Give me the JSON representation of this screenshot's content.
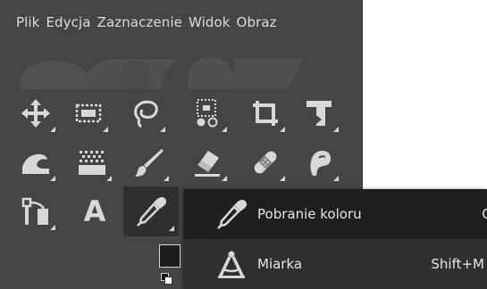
{
  "menubar": {
    "items": [
      {
        "label": "Plik"
      },
      {
        "label": "Edycja"
      },
      {
        "label": "Zaznaczenie"
      },
      {
        "label": "Widok"
      },
      {
        "label": "Obraz"
      }
    ]
  },
  "toolbox": {
    "text_tool_glyph": "A"
  },
  "popup": {
    "items": [
      {
        "label": "Pobranie koloru",
        "shortcut": "O"
      },
      {
        "label": "Miarka",
        "shortcut": "Shift+M"
      }
    ]
  },
  "colors": {
    "toolbox_bg": "#454545",
    "icon": "#d8d8d8",
    "popup_bg": "#2f2f2f",
    "popup_selected": "#1f1f1f"
  }
}
